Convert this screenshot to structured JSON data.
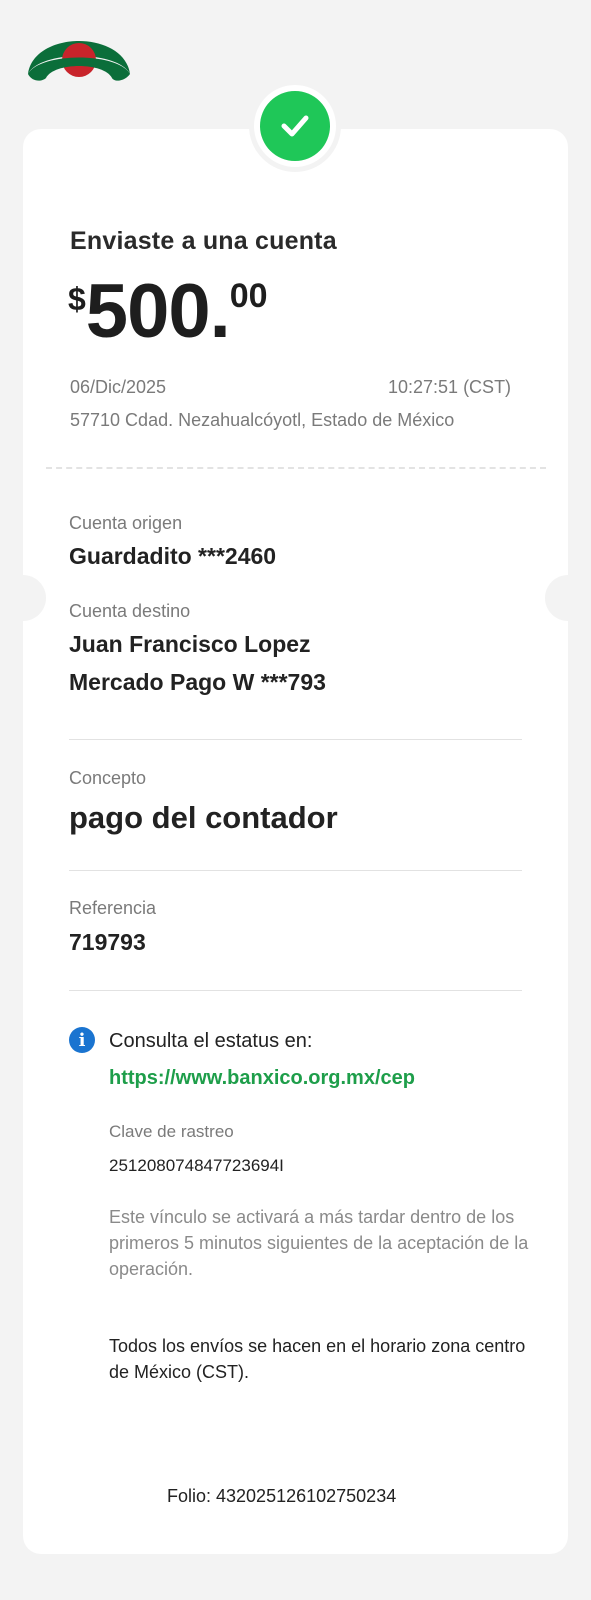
{
  "header": {
    "logo_icon": "bank-logo-icon"
  },
  "status": {
    "icon": "check-icon",
    "color": "#1fc758"
  },
  "transfer": {
    "title": "Enviaste a una cuenta",
    "currency_symbol": "$",
    "amount_int": "500.",
    "amount_cents": "00",
    "date": "06/Dic/2025",
    "time": "10:27:51 (CST)",
    "location": "57710 Cdad. Nezahualcóyotl, Estado de México"
  },
  "details": {
    "origin_label": "Cuenta origen",
    "origin_value": "Guardadito ***2460",
    "destination_label": "Cuenta destino",
    "destination_name": "Juan Francisco Lopez",
    "destination_account": "Mercado Pago W ***793",
    "concept_label": "Concepto",
    "concept_value": "pago del contador",
    "reference_label": "Referencia",
    "reference_value": "719793"
  },
  "status_info": {
    "info_icon": "info-icon",
    "consult_text": "Consulta el estatus en:",
    "link_text": "https://www.banxico.org.mx/cep",
    "tracking_label": "Clave de rastreo",
    "tracking_value": "251208074847723694I",
    "activation_note": "Este vínculo se activará a más tardar dentro de los primeros 5 minutos siguientes de la aceptación de la operación.",
    "timezone_note": "Todos los envíos se hacen en el horario zona centro de México (CST)."
  },
  "footer": {
    "folio": "Folio: 432025126102750234"
  },
  "colors": {
    "accent_green": "#1e9e4a",
    "info_blue": "#1a74d0",
    "logo_green": "#0b6e3a",
    "logo_red": "#c8242b"
  }
}
